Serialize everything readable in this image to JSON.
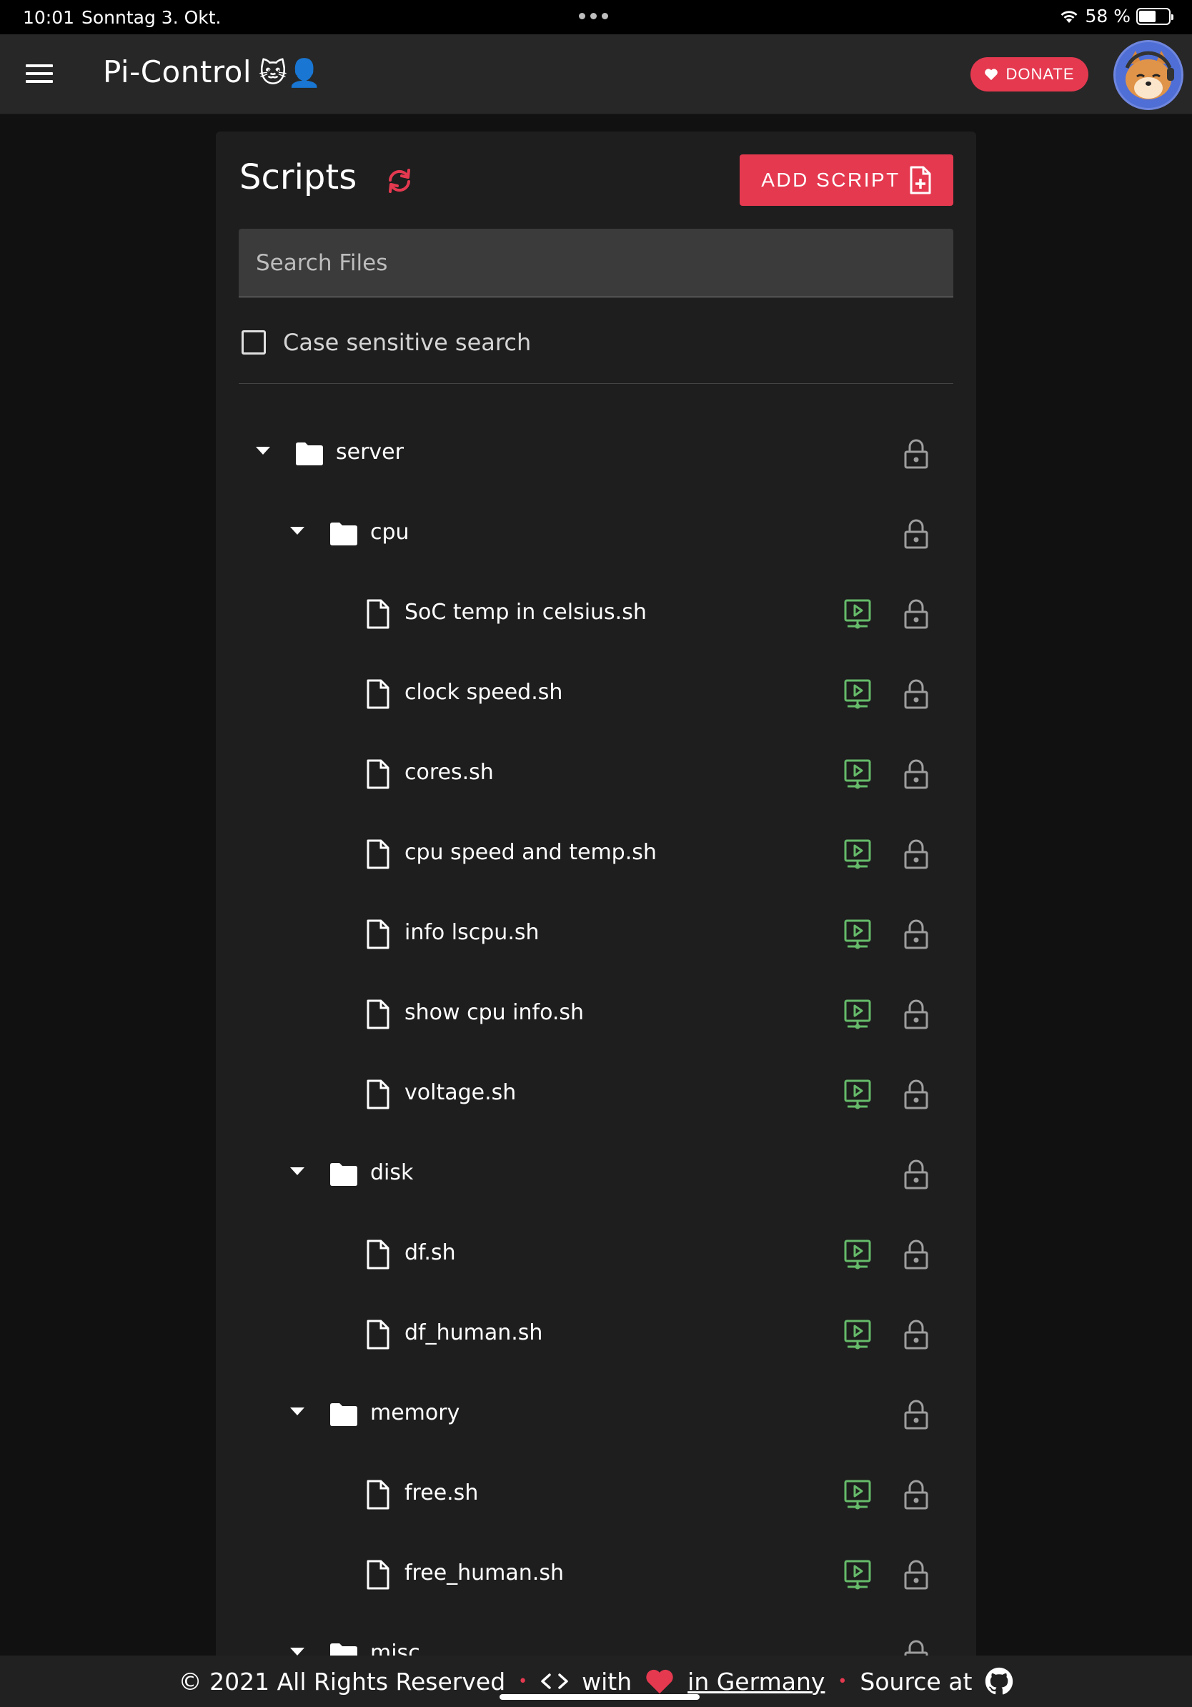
{
  "statusbar": {
    "time": "10:01",
    "date": "Sonntag 3. Okt.",
    "battery": "58 %",
    "battery_level": 0.58
  },
  "appbar": {
    "title": "Pi-Control",
    "title_emoji": "🐱👤",
    "donate_label": "DONATE"
  },
  "page": {
    "title": "Scripts",
    "add_label": "ADD SCRIPT",
    "search_placeholder": "Search Files",
    "case_label": "Case sensitive search"
  },
  "tree": [
    {
      "type": "folder",
      "depth": 0,
      "name": "server"
    },
    {
      "type": "folder",
      "depth": 1,
      "name": "cpu"
    },
    {
      "type": "file",
      "depth": 2,
      "name": "SoC temp in celsius.sh"
    },
    {
      "type": "file",
      "depth": 2,
      "name": "clock speed.sh"
    },
    {
      "type": "file",
      "depth": 2,
      "name": "cores.sh"
    },
    {
      "type": "file",
      "depth": 2,
      "name": "cpu speed and temp.sh"
    },
    {
      "type": "file",
      "depth": 2,
      "name": "info lscpu.sh"
    },
    {
      "type": "file",
      "depth": 2,
      "name": "show cpu info.sh"
    },
    {
      "type": "file",
      "depth": 2,
      "name": "voltage.sh"
    },
    {
      "type": "folder",
      "depth": 1,
      "name": "disk"
    },
    {
      "type": "file",
      "depth": 2,
      "name": "df.sh"
    },
    {
      "type": "file",
      "depth": 2,
      "name": "df_human.sh"
    },
    {
      "type": "folder",
      "depth": 1,
      "name": "memory"
    },
    {
      "type": "file",
      "depth": 2,
      "name": "free.sh"
    },
    {
      "type": "file",
      "depth": 2,
      "name": "free_human.sh"
    },
    {
      "type": "folder",
      "depth": 1,
      "name": "misc"
    }
  ],
  "footer": {
    "copyright": "© 2021 All Rights Reserved",
    "with": "with",
    "country": "in Germany",
    "source": "Source at"
  },
  "colors": {
    "accent": "#e53950",
    "run": "#66bb6a",
    "lock": "#9e9e9e",
    "card": "#1e1e1e"
  },
  "icons": {
    "folder": "folder-icon",
    "file": "file-icon",
    "run": "run-script-icon",
    "lock": "lock-icon",
    "refresh": "refresh-icon",
    "add": "file-plus-icon",
    "github": "github-icon",
    "heart": "heart-icon",
    "code": "code-icon"
  }
}
